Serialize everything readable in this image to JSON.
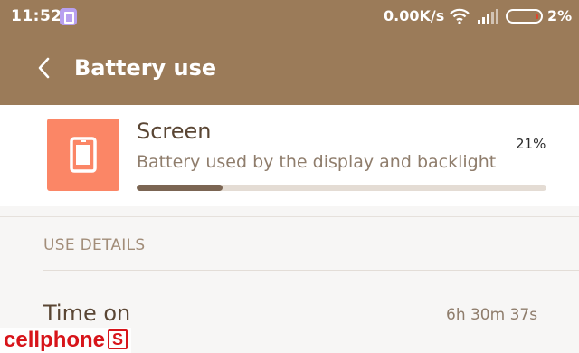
{
  "status_bar": {
    "time": "11:52",
    "net_speed": "0.00K/s",
    "battery_percent": "2%",
    "battery_level_fraction": 0.02,
    "icons": [
      "notification-app-icon",
      "wifi-icon",
      "signal-icon",
      "battery-icon"
    ]
  },
  "header": {
    "back_icon": "chevron-left-icon",
    "title": "Battery use"
  },
  "item": {
    "icon": "screen-icon",
    "icon_color": "#fb8666",
    "title": "Screen",
    "description": "Battery used by the display and backlight",
    "percent_label": "21%",
    "usage_fraction": 0.21
  },
  "details": {
    "section_header": "USE DETAILS",
    "rows": [
      {
        "label": "Time on",
        "value": "6h 30m 37s"
      }
    ]
  },
  "watermark": {
    "text": "cellphone",
    "logo_letter": "S"
  },
  "colors": {
    "header_bg": "#9b7b59",
    "progress_fill": "#7b6553",
    "progress_track": "#e4dcd4",
    "watermark": "#d7141a"
  }
}
